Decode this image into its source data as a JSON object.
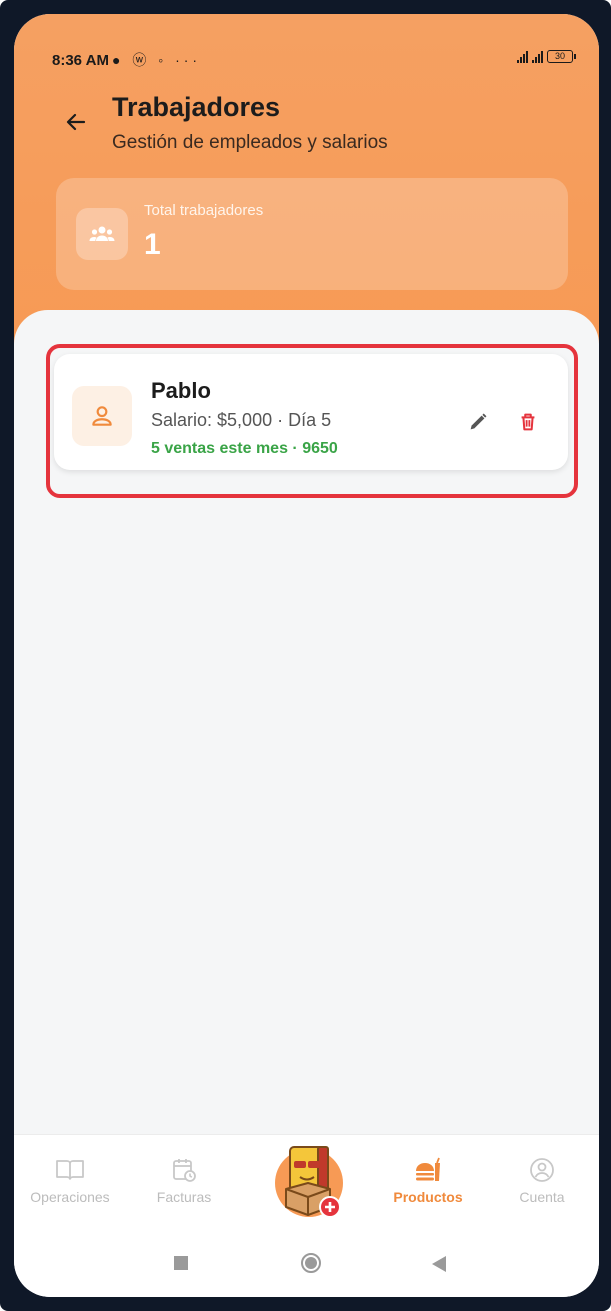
{
  "status_bar": {
    "time": "8:36 AM",
    "icons": "● ⓦ ◦ ···",
    "battery": "30"
  },
  "header": {
    "title": "Trabajadores",
    "subtitle": "Gestión de empleados y salarios"
  },
  "stat": {
    "label": "Total trabajadores",
    "value": "1"
  },
  "workers": [
    {
      "name": "Pablo",
      "salary_line": "Salario: $5,000 · Día 5",
      "sales_line": "5 ventas este mes · 9650"
    }
  ],
  "bottom_nav": {
    "items": [
      {
        "label": "Operaciones",
        "icon": "book-icon",
        "active": false
      },
      {
        "label": "Facturas",
        "icon": "calendar-clock-icon",
        "active": false
      },
      {
        "label": "Productos",
        "icon": "food-icon",
        "active": true
      },
      {
        "label": "Cuenta",
        "icon": "account-icon",
        "active": false
      }
    ]
  },
  "colors": {
    "accent": "#f79a55",
    "sales_green": "#3aa447",
    "delete_red": "#e5343d",
    "highlight_red": "#e5343d"
  }
}
